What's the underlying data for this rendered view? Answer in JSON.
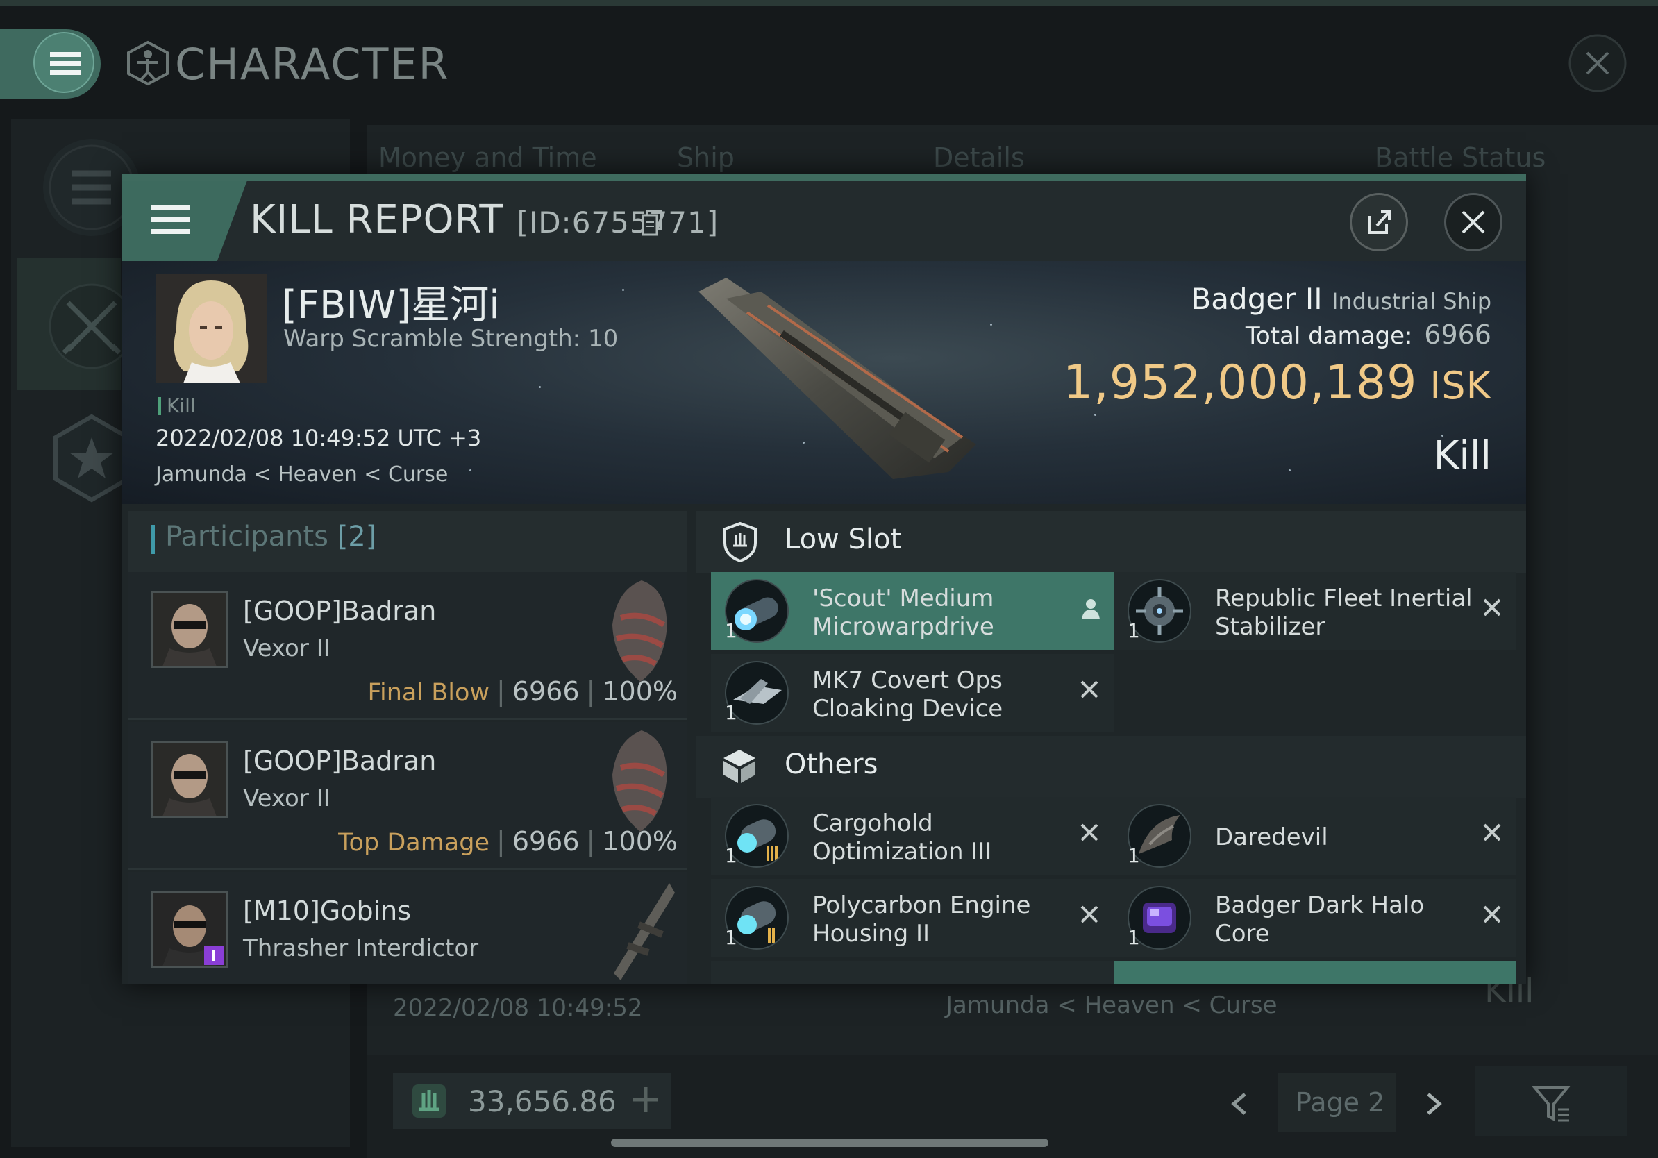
{
  "background": {
    "window_title": "CHARACTER",
    "tabs": [
      "Money and Time",
      "Ship",
      "Details",
      "Battle Status"
    ],
    "row_time": "2022/02/08 10:49:52",
    "row_location": "Jamunda < Heaven < Curse",
    "row_result": "Kill",
    "isk_balance": "33,656.86",
    "page_label": "Page 2"
  },
  "kill_report": {
    "title": "KILL REPORT",
    "report_id": "[ID:6755771]",
    "victim": {
      "name": "[FBIW]星河i",
      "warp_scramble": "Warp Scramble Strength: 10",
      "tag": "Kill",
      "time": "2022/02/08 10:49:52 UTC +3",
      "location": "Jamunda < Heaven < Curse"
    },
    "ship": {
      "name": "Badger II",
      "class": "Industrial Ship",
      "total_damage_label": "Total damage:",
      "total_damage": "6966",
      "isk_value": "1,952,000,189",
      "isk_unit": "ISK",
      "result": "Kill"
    },
    "participants": {
      "label": "Participants",
      "count": "[2]",
      "rows": [
        {
          "name": "[GOOP]Badran",
          "ship": "Vexor II",
          "tag": "Final Blow",
          "damage": "6966",
          "percent": "100%"
        },
        {
          "name": "[GOOP]Badran",
          "ship": "Vexor II",
          "tag": "Top Damage",
          "damage": "6966",
          "percent": "100%"
        },
        {
          "name": "[M10]Gobins",
          "ship": "Thrasher Interdictor",
          "tag": "",
          "damage": "",
          "percent": ""
        }
      ]
    },
    "low_slot": {
      "title": "Low Slot",
      "items": [
        {
          "name": "'Scout' Medium Microwarpdrive",
          "qty": "1"
        },
        {
          "name": "Republic Fleet Inertial Stabilizer",
          "qty": "1"
        },
        {
          "name": "MK7 Covert Ops Cloaking Device",
          "qty": "1"
        }
      ]
    },
    "others": {
      "title": "Others",
      "items": [
        {
          "name": "Cargohold Optimization III",
          "qty": "1"
        },
        {
          "name": "Daredevil",
          "qty": "1"
        },
        {
          "name": "Polycarbon Engine Housing II",
          "qty": "1"
        },
        {
          "name": "Badger Dark Halo Core",
          "qty": "1"
        }
      ]
    }
  },
  "colors": {
    "accent_green": "#3e7668",
    "isk_gold": "#f0c987",
    "tag_gold": "#c9a05c",
    "participants_blue": "#3f9aa9"
  },
  "icons": [
    "menu-icon",
    "vitruvian-icon",
    "close-icon",
    "share-icon",
    "copy-icon",
    "shield-slot-icon",
    "cube-icon",
    "person-icon",
    "remove-icon",
    "star-icon",
    "crossed-swords-icon",
    "isk-icon",
    "filter-icon"
  ]
}
